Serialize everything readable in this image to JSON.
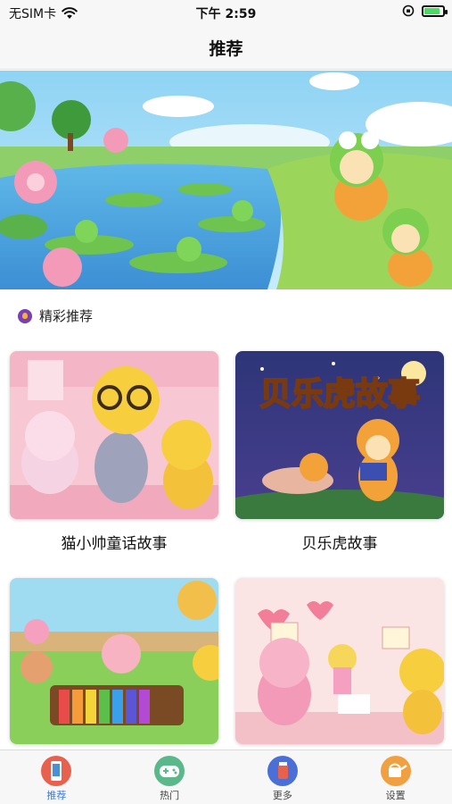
{
  "status_bar": {
    "carrier": "无SIM卡",
    "time": "下午 2:59",
    "battery_level": 0.85
  },
  "nav": {
    "title": "推荐"
  },
  "section": {
    "label": "精彩推荐"
  },
  "cards": [
    {
      "title": "猫小帅童话故事"
    },
    {
      "title": "贝乐虎故事",
      "thumb_text": "贝乐虎故事"
    },
    {
      "title": ""
    },
    {
      "title": ""
    }
  ],
  "tabs": [
    {
      "label": "推荐",
      "icon": "phone-icon",
      "color": "#e8614f"
    },
    {
      "label": "热门",
      "icon": "gamepad-icon",
      "color": "#5bb88a"
    },
    {
      "label": "更多",
      "icon": "cup-icon",
      "color": "#4a6fd6"
    },
    {
      "label": "设置",
      "icon": "watering-can-icon",
      "color": "#f0a040"
    }
  ],
  "colors": {
    "accent": "#3d7ae0",
    "bar_background": "#f7f7f7"
  }
}
